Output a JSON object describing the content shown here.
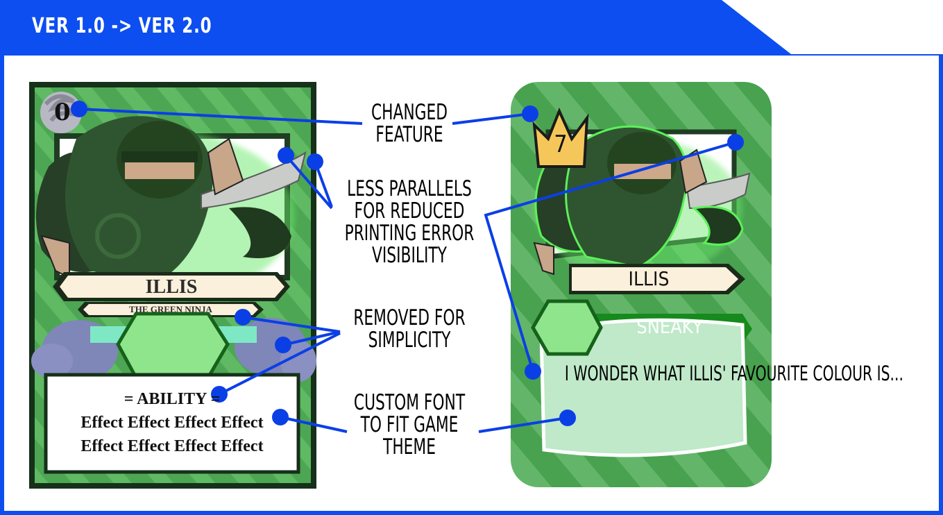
{
  "header": {
    "title": "VER 1.0 -> VER 2.0"
  },
  "annotations": {
    "changed_feature": "CHANGED\nFEATURE",
    "less_parallels": "LESS PARALLELS\nFOR REDUCED\nPRINTING ERROR\nVISIBILITY",
    "removed": "REMOVED FOR\nSIMPLICITY",
    "custom_font": "CUSTOM FONT\nTO FIT GAME\nTHEME"
  },
  "old_card": {
    "cost": "0",
    "name": "ILLIS",
    "subtitle": "THE GREEN NINJA",
    "ability_heading": "= ABILITY =",
    "effect_line_1": "Effect Effect Effect Effect",
    "effect_line_2": "Effect Effect Effect Effect"
  },
  "new_card": {
    "cost": "7",
    "name": "ILLIS",
    "trait": "SNEAKY",
    "flavor": "I WONDER WHAT\nILLIS' FAVOURITE\nCOLOUR IS..."
  },
  "colors": {
    "header_blue": "#0d4ef0",
    "pointer_blue": "#0b3fe6",
    "card_green": "#4caf50",
    "card_dark": "#1f3d22",
    "crown_gold": "#f5c75a"
  }
}
